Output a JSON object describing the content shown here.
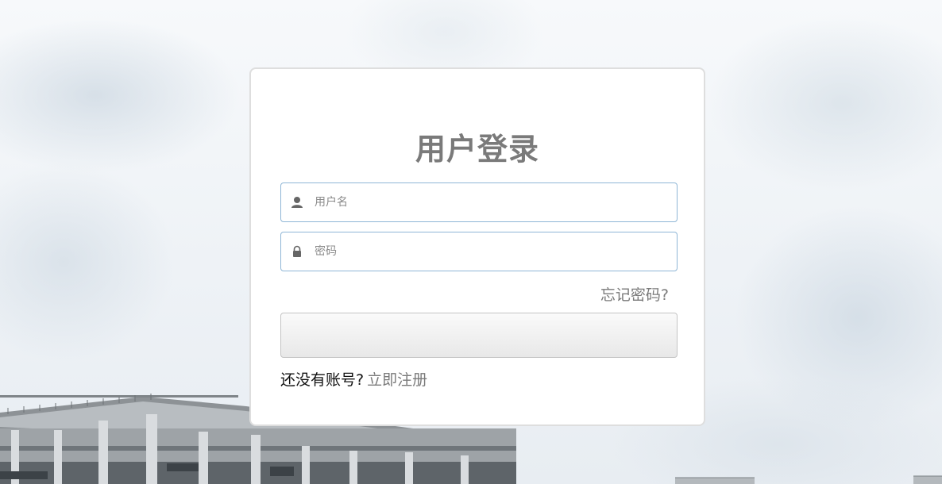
{
  "login": {
    "title": "用户登录",
    "username": {
      "placeholder": "用户名",
      "value": "",
      "icon": "user-icon"
    },
    "password": {
      "placeholder": "密码",
      "value": "",
      "icon": "lock-icon"
    },
    "forgot_password": "忘记密码?",
    "submit_label": "",
    "register_prompt": "还没有账号?",
    "register_link": "立即注册"
  },
  "colors": {
    "title": "#7a7a7a",
    "input_border": "#8fb6d6",
    "link": "#7a7a7a",
    "card_border": "#dedede"
  }
}
